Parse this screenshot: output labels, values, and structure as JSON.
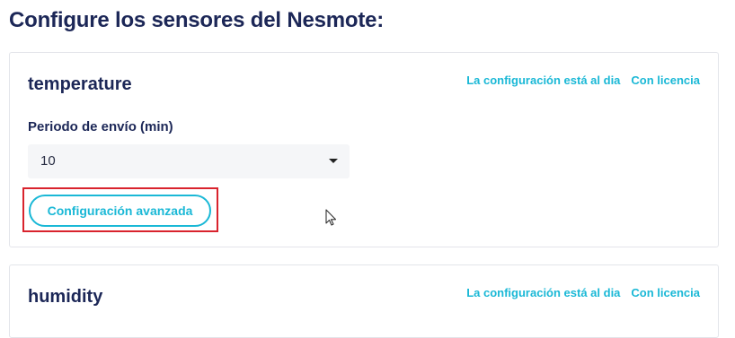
{
  "page": {
    "title": "Configure los sensores del Nesmote:"
  },
  "sensors": [
    {
      "name": "temperature",
      "status_config": "La configuración está al dia",
      "status_license": "Con licencia",
      "period_label": "Periodo de envío (min)",
      "period_value": "10",
      "advanced_button": "Configuración avanzada"
    },
    {
      "name": "humidity",
      "status_config": "La configuración está al dia",
      "status_license": "Con licencia"
    }
  ],
  "colors": {
    "accent": "#1ab8d6",
    "title": "#1c2757",
    "highlight": "#d9232d"
  },
  "icons": {
    "dropdown": "caret-down-icon",
    "cursor": "mouse-pointer-icon"
  }
}
